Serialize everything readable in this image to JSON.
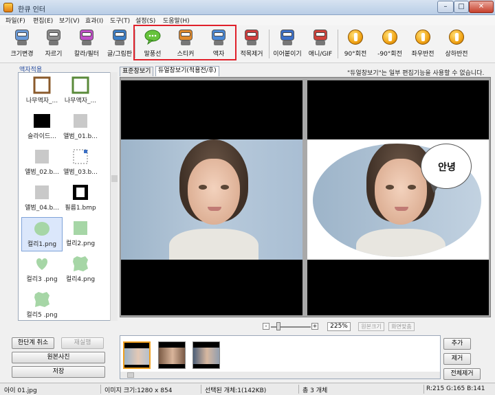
{
  "window": {
    "title": "한큐 인터",
    "minimize": "–",
    "maximize": "□",
    "close": "✕"
  },
  "menu": [
    "파일(F)",
    "편집(E)",
    "보기(V)",
    "효과(I)",
    "도구(T)",
    "설정(S)",
    "도움말(H)"
  ],
  "toolbar": [
    {
      "label": "크기변경",
      "icon": "resize-robot-icon",
      "color": "#6a9ad8"
    },
    {
      "label": "자르기",
      "icon": "crop-robot-icon",
      "color": "#8e8e8e"
    },
    {
      "label": "칼라/필터",
      "icon": "color-filter-robot-icon",
      "color": "#c04fc8"
    },
    {
      "label": "글/그림판",
      "icon": "text-paint-robot-icon",
      "color": "#3d7fc8"
    },
    {
      "label": "말풍선",
      "icon": "speech-bubble-icon",
      "color": "#66c33b"
    },
    {
      "label": "스티커",
      "icon": "sticker-robot-icon",
      "color": "#e08a2c"
    },
    {
      "label": "액자",
      "icon": "frame-robot-icon",
      "color": "#4a88d6"
    },
    {
      "label": "적목제거",
      "icon": "red-eye-robot-icon",
      "color": "#d23d3d"
    },
    {
      "label": "이어붙이기",
      "icon": "merge-robot-icon",
      "color": "#3c70c9"
    },
    {
      "label": "애니/GIF",
      "icon": "gif-robot-icon",
      "color": "#d0423a"
    },
    {
      "label": "90°회전",
      "icon": "rotate-90-icon",
      "color": "#f1a416"
    },
    {
      "label": "-90°회전",
      "icon": "rotate-minus-90-icon",
      "color": "#f1a416"
    },
    {
      "label": "좌우반전",
      "icon": "flip-horizontal-icon",
      "color": "#f1a416"
    },
    {
      "label": "상하반전",
      "icon": "flip-vertical-icon",
      "color": "#f1a416"
    }
  ],
  "left_panel": {
    "title": "액자적용",
    "items": [
      {
        "label": "나무액자_...",
        "kind": "wood-frame"
      },
      {
        "label": "나무액자_...",
        "kind": "green-frame"
      },
      {
        "label": "슬라이드...",
        "kind": "black-square"
      },
      {
        "label": "앨범_01.b...",
        "kind": "gray-square"
      },
      {
        "label": "앨범_02.b...",
        "kind": "gray-square"
      },
      {
        "label": "앨범_03.b...",
        "kind": "dotted-square"
      },
      {
        "label": "앨범_04.b...",
        "kind": "gray-square"
      },
      {
        "label": "필름1.bmp",
        "kind": "film"
      },
      {
        "label": "컬리1.png",
        "kind": "green-blob",
        "selected": true
      },
      {
        "label": "컬리2.png",
        "kind": "green-square"
      },
      {
        "label": "컬리3 .png",
        "kind": "green-heart"
      },
      {
        "label": "컬리4.png",
        "kind": "green-rough"
      },
      {
        "label": "컬리5 .png",
        "kind": "green-rough"
      }
    ]
  },
  "left_buttons": {
    "undo": "한단계 취소",
    "redo": "재실행",
    "original": "원본사진",
    "save": "저장"
  },
  "tabs": {
    "standard": "표준창보기",
    "dual": "듀얼창보기(적용전/후)"
  },
  "notice": "\"듀얼창보기\"는 일부 편집기능을 사용할 수 없습니다.",
  "preview": {
    "bubble_text": "안녕"
  },
  "zoom": {
    "minus": "-",
    "plus": "+",
    "value": "225%",
    "original_size": "원본크기",
    "fit_screen": "화면맞춤"
  },
  "right_buttons": {
    "add": "추가",
    "remove": "제거",
    "remove_all": "전체제거"
  },
  "status": {
    "filename": "아이 01.jpg",
    "image_size": "이미지 크기:1280 x 854",
    "selected": "선택된 개체:1(142KB)",
    "total": "총 3 개체",
    "rgb": "R:215 G:165 B:141"
  }
}
